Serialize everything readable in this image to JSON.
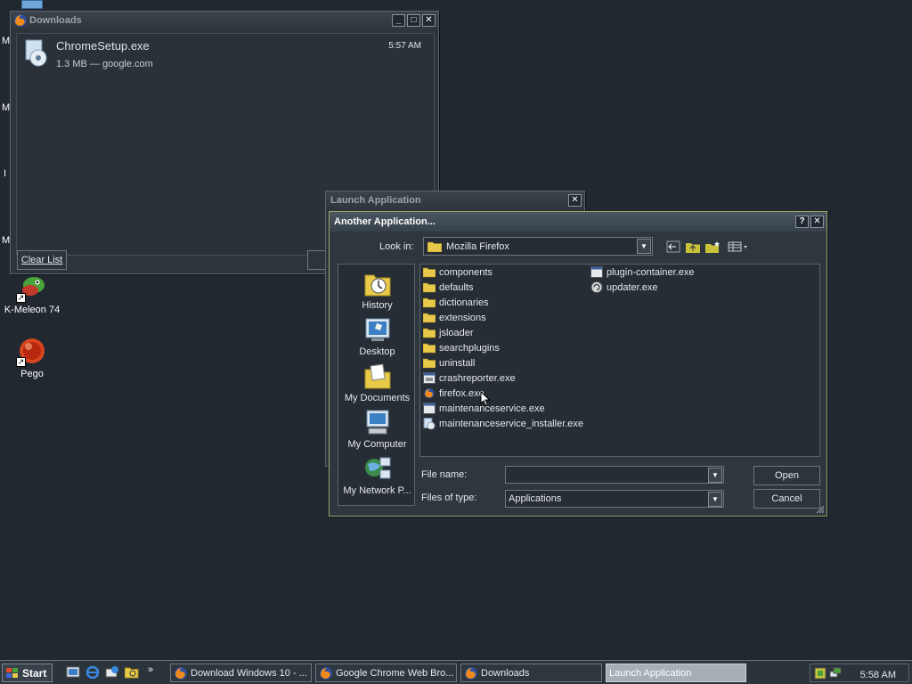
{
  "desktop": {
    "partial_labels": [
      "M",
      "M",
      "I",
      "M"
    ],
    "icons": [
      {
        "label": "K-Meleon 74",
        "icon": "k-meleon-icon"
      },
      {
        "label": "Pego",
        "icon": "pego-icon"
      }
    ]
  },
  "downloads_window": {
    "title": "Downloads",
    "items": [
      {
        "name": "ChromeSetup.exe",
        "meta": "1.3 MB — google.com",
        "time": "5:57 AM"
      }
    ],
    "clear_list_label": "Clear List"
  },
  "launch_window": {
    "title": "Launch Application"
  },
  "dialog": {
    "title": "Another Application...",
    "look_in_label": "Look in:",
    "look_in_value": "Mozilla Firefox",
    "places": [
      {
        "label": "History",
        "icon": "history-icon"
      },
      {
        "label": "Desktop",
        "icon": "desktop-icon"
      },
      {
        "label": "My Documents",
        "icon": "my-documents-icon"
      },
      {
        "label": "My Computer",
        "icon": "my-computer-icon"
      },
      {
        "label": "My Network P...",
        "icon": "my-network-places-icon"
      }
    ],
    "files_col1": [
      {
        "name": "components",
        "type": "folder"
      },
      {
        "name": "defaults",
        "type": "folder"
      },
      {
        "name": "dictionaries",
        "type": "folder"
      },
      {
        "name": "extensions",
        "type": "folder"
      },
      {
        "name": "jsloader",
        "type": "folder"
      },
      {
        "name": "searchplugins",
        "type": "folder"
      },
      {
        "name": "uninstall",
        "type": "folder"
      },
      {
        "name": "crashreporter.exe",
        "type": "exe"
      },
      {
        "name": "firefox.exe",
        "type": "firefox"
      },
      {
        "name": "maintenanceservice.exe",
        "type": "exe"
      },
      {
        "name": "maintenanceservice_installer.exe",
        "type": "installer"
      }
    ],
    "files_col2": [
      {
        "name": "plugin-container.exe",
        "type": "exe"
      },
      {
        "name": "updater.exe",
        "type": "updater"
      }
    ],
    "file_name_label": "File name:",
    "file_name_value": "",
    "files_of_type_label": "Files of type:",
    "files_of_type_value": "Applications",
    "open_label": "Open",
    "cancel_label": "Cancel"
  },
  "taskbar": {
    "start_label": "Start",
    "tasks": [
      {
        "label": "Download Windows 10 - ...",
        "active": false
      },
      {
        "label": "Google Chrome Web Bro...",
        "active": false
      },
      {
        "label": "Downloads",
        "active": false
      },
      {
        "label": "Launch Application",
        "active": true
      }
    ],
    "clock": "5:58 AM"
  },
  "colors": {
    "desktop_bg": "#212830",
    "window_bg": "#2c343c",
    "dialog_border": "#9aa46a",
    "folder": "#e8c94a",
    "active_task": "#a6aeb6"
  }
}
